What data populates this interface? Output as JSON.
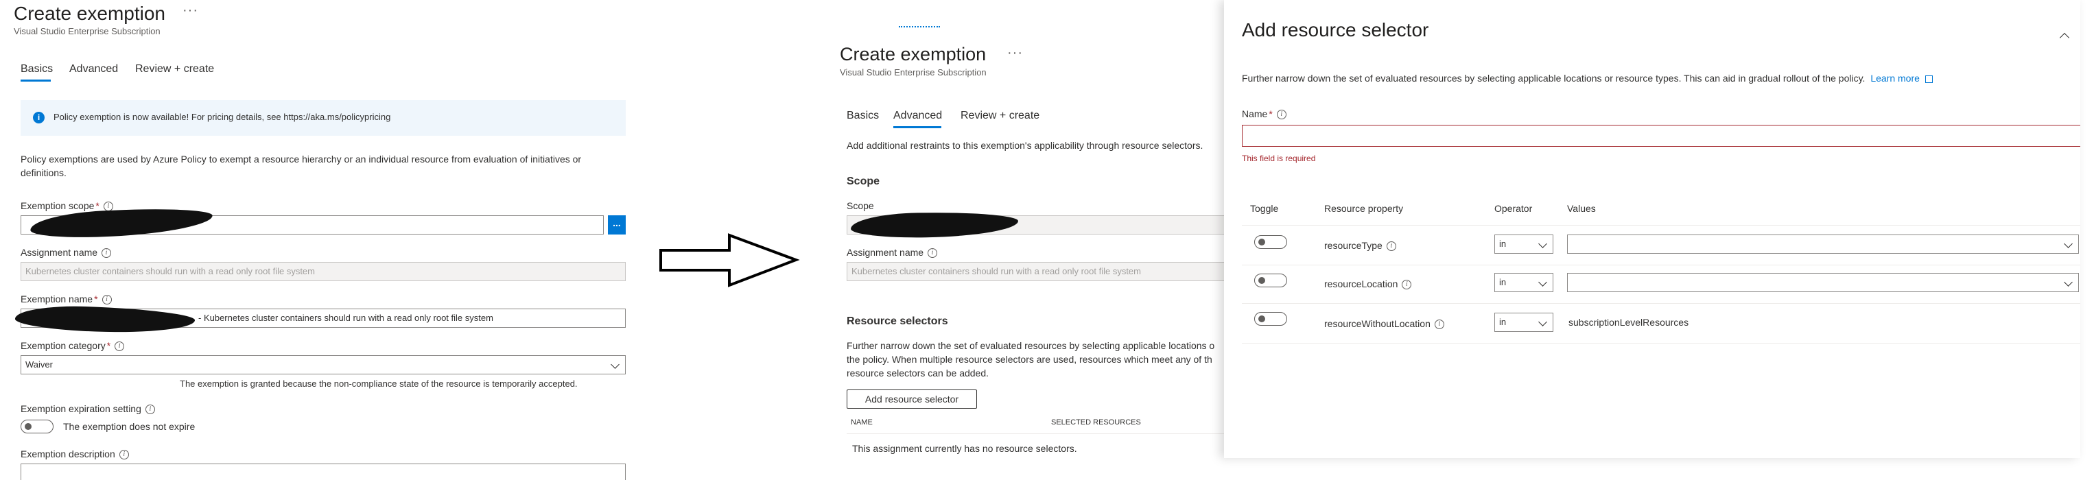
{
  "left": {
    "title": "Create exemption",
    "subtitle": "Visual Studio Enterprise Subscription",
    "more": "···",
    "tabs": [
      {
        "label": "Basics"
      },
      {
        "label": "Advanced"
      },
      {
        "label": "Review + create"
      }
    ],
    "info_banner": "Policy exemption is now available! For pricing details, see https://aka.ms/policypricing",
    "description": "Policy exemptions are used by Azure Policy to exempt a resource hierarchy or an individual resource from evaluation of initiatives or definitions.",
    "exemption_scope_label": "Exemption scope",
    "scope_browse": "...",
    "assignment_name_label": "Assignment name",
    "assignment_name_value": "Kubernetes cluster containers should run with a read only root file system",
    "exemption_name_label": "Exemption name",
    "exemption_name_value": "- Kubernetes cluster containers should run with a read only root file system",
    "exemption_category_label": "Exemption category",
    "exemption_category_value": "Waiver",
    "category_help": "The exemption is granted because the non-compliance state of the resource is temporarily accepted.",
    "expiration_label": "Exemption expiration setting",
    "expiration_toggle_text": "The exemption does not expire",
    "description_label": "Exemption description"
  },
  "middle": {
    "title": "Create exemption",
    "more": "···",
    "subtitle": "Visual Studio Enterprise Subscription",
    "tabs": [
      {
        "label": "Basics"
      },
      {
        "label": "Advanced"
      },
      {
        "label": "Review + create"
      }
    ],
    "intro": "Add additional restraints to this exemption's applicability through resource selectors.",
    "scope_heading": "Scope",
    "scope_label": "Scope",
    "assignment_name_label": "Assignment name",
    "assignment_name_value": "Kubernetes cluster containers should run with a read only root file system",
    "resource_selectors_heading": "Resource selectors",
    "rs_desc_line1": "Further narrow down the set of evaluated resources by selecting applicable locations o",
    "rs_desc_line2": "the policy. When multiple resource selectors are used, resources which meet any of th",
    "rs_desc_line3": "resource selectors can be added.",
    "add_button": "Add resource selector",
    "col_name": "NAME",
    "col_selected": "SELECTED RESOURCES",
    "empty_msg": "This assignment currently has no resource selectors."
  },
  "panel": {
    "title": "Add resource selector",
    "description": "Further narrow down the set of evaluated resources by selecting applicable locations or resource types. This can aid in gradual rollout of the policy.",
    "learn_more": "Learn more",
    "name_label": "Name",
    "name_error": "This field is required",
    "headers": {
      "toggle": "Toggle",
      "property": "Resource property",
      "operator": "Operator",
      "values": "Values"
    },
    "rows": [
      {
        "property": "resourceType",
        "operator": "in",
        "value": ""
      },
      {
        "property": "resourceLocation",
        "operator": "in",
        "value": ""
      },
      {
        "property": "resourceWithoutLocation",
        "operator": "in",
        "value": "subscriptionLevelResources"
      }
    ]
  },
  "colors": {
    "accent": "#0078d4",
    "error": "#a4262c",
    "banner_bg": "#eff6fc"
  },
  "icons": [
    "info-icon",
    "arrow-right-icon",
    "chevron-down-icon",
    "chevron-up-icon",
    "external-link-icon"
  ]
}
